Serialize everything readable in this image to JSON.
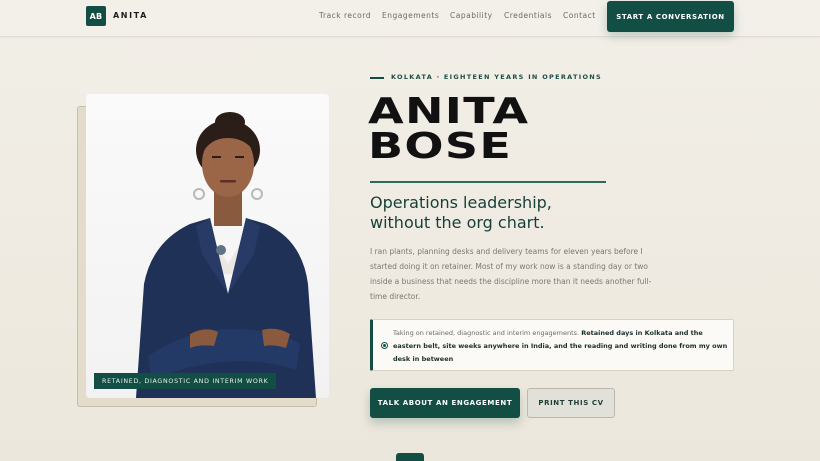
{
  "header": {
    "logo_mark": "AB",
    "logo_name": "ANITA",
    "nav": [
      "Track record",
      "Engagements",
      "Capability",
      "Credentials",
      "Contact"
    ],
    "cta": "START A CONVERSATION"
  },
  "hero": {
    "photo_caption": "RETAINED, DIAGNOSTIC AND INTERIM WORK",
    "eyebrow": "KOLKATA · EIGHTEEN YEARS IN OPERATIONS",
    "name_line1": "ANITA",
    "name_line2": "BOSE",
    "tagline_line1": "Operations leadership,",
    "tagline_line2": "without the org chart.",
    "bio_lines": [
      "I ran plants, planning desks and delivery teams for eleven years before I",
      "started doing it on retainer. Most of my work now is a standing day or two",
      "inside a business that needs the discipline more than it needs another full-",
      "time director."
    ],
    "note": {
      "intro": "Taking on retained, diagnostic and interim engagements.",
      "bold_line1": "Retained days in Kolkata and the",
      "bold_line2": "eastern belt, site weeks anywhere in India, and the reading and writing done from my own",
      "bold_line3": "desk in between"
    },
    "primary_button": "TALK ABOUT AN ENGAGEMENT",
    "secondary_button": "PRINT THIS CV"
  },
  "colors": {
    "accent": "#134e45",
    "background": "#f0ece3"
  }
}
